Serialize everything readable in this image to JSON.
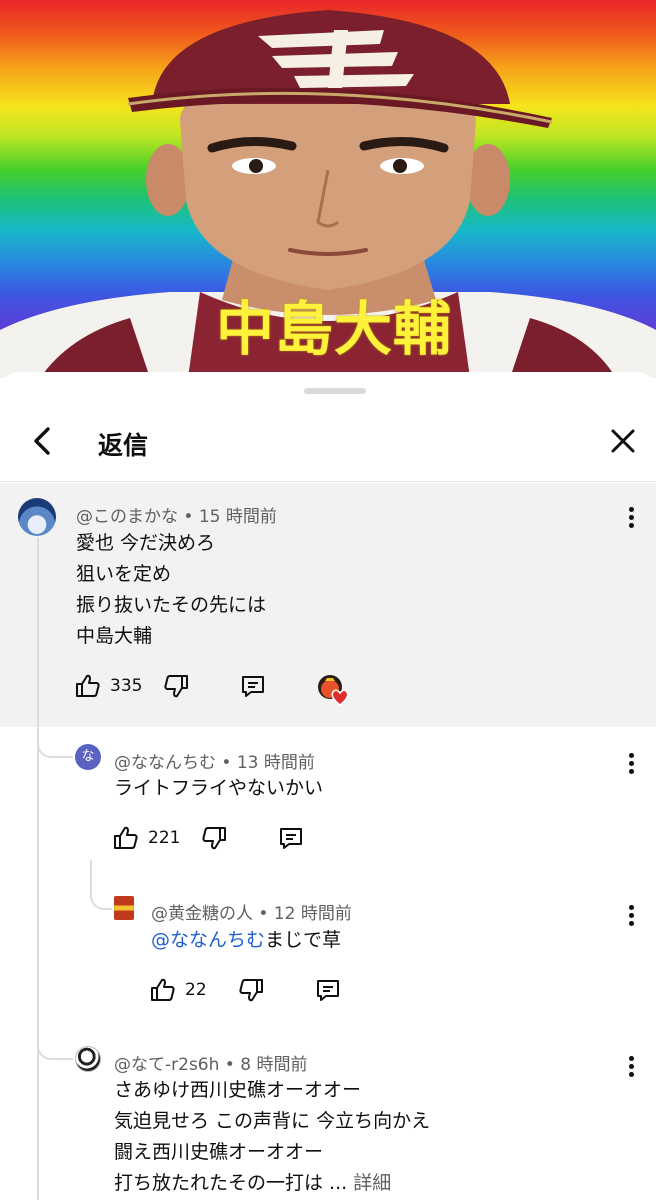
{
  "video": {
    "caption": "中島大輔",
    "cap_letter": "E"
  },
  "header": {
    "title": "返信"
  },
  "comments": [
    {
      "author": "@このまかな",
      "time": "15 時間前",
      "lines": [
        "愛也 今だ決めろ",
        "狙いを定め",
        "振り抜いたその先には",
        "中島大輔"
      ],
      "likes": "335",
      "creator_heart": true
    },
    {
      "author": "@ななんちむ",
      "time": "13 時間前",
      "avatar_letter": "な",
      "lines": [
        "ライトフライやないかい"
      ],
      "likes": "221"
    },
    {
      "author": "@黄金糖の人",
      "time": "12 時間前",
      "mention": "@ななんちむ",
      "text_after_mention": "まじで草",
      "likes": "22"
    },
    {
      "author": "@なて-r2s6h",
      "time": "8 時間前",
      "lines": [
        "さあゆけ西川史礁オーオオー",
        "気迫見せろ この声背に 今立ち向かえ",
        "闘え西川史礁オーオオー",
        "打ち放たれたその一打は ..."
      ],
      "more_label": "詳細"
    }
  ],
  "icons": {
    "back": "chevron-left-icon",
    "close": "close-icon",
    "like": "thumbs-up-icon",
    "dislike": "thumbs-down-icon",
    "reply": "reply-comment-icon",
    "more": "more-vert-icon",
    "heart": "creator-heart-icon"
  },
  "colors": {
    "mention": "#1f5fd1",
    "heart": "#e02c2c",
    "highlight_bg": "#f2f2f2",
    "cap": "#7a1f2b"
  }
}
